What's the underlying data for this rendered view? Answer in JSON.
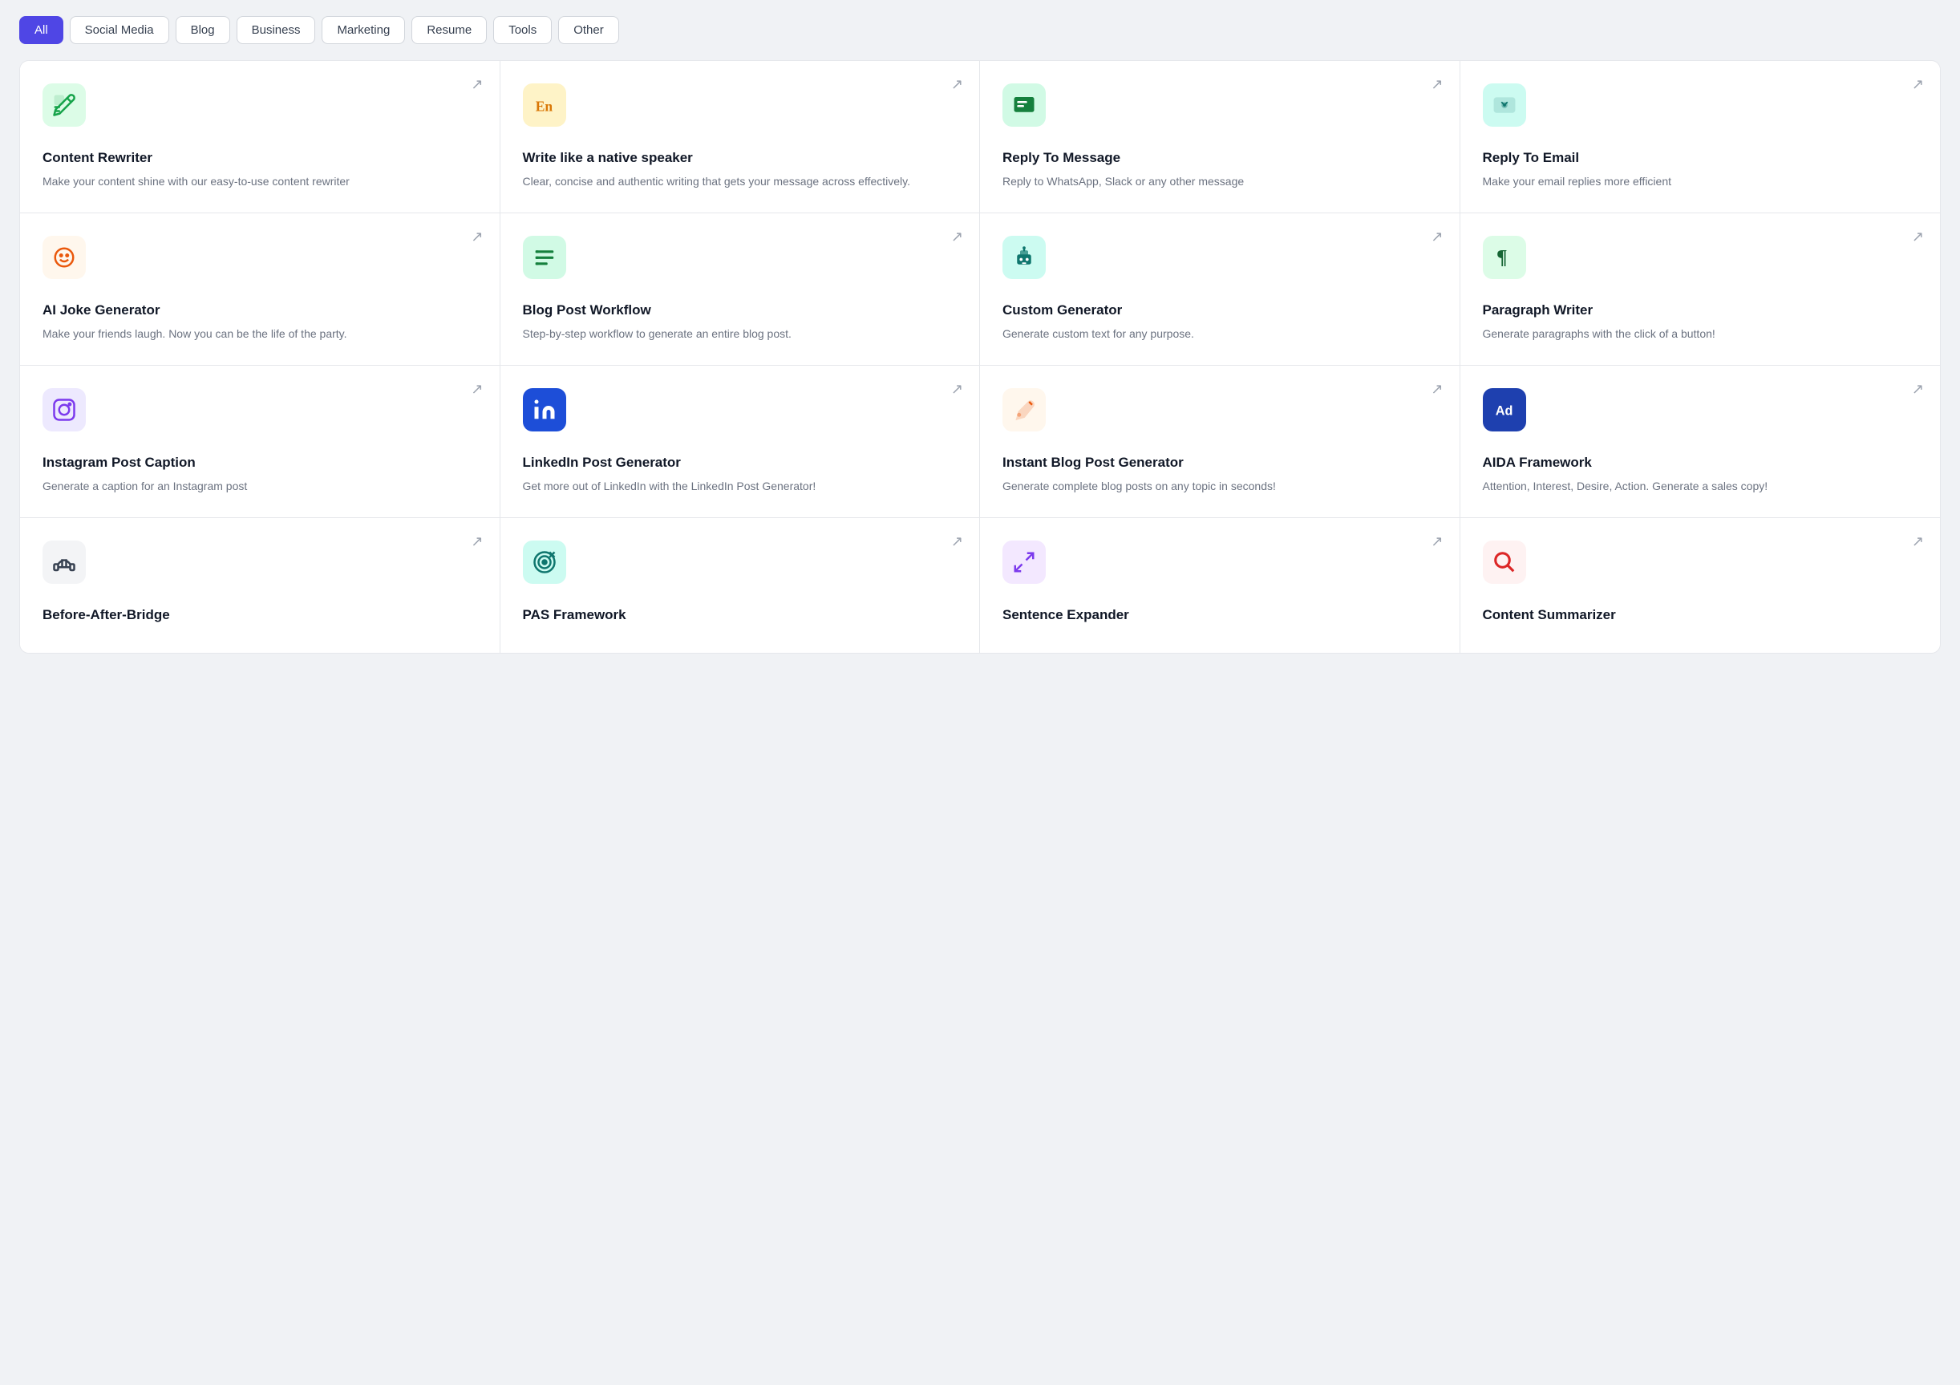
{
  "filters": {
    "items": [
      {
        "label": "All",
        "active": true
      },
      {
        "label": "Social Media",
        "active": false
      },
      {
        "label": "Blog",
        "active": false
      },
      {
        "label": "Business",
        "active": false
      },
      {
        "label": "Marketing",
        "active": false
      },
      {
        "label": "Resume",
        "active": false
      },
      {
        "label": "Tools",
        "active": false
      },
      {
        "label": "Other",
        "active": false
      }
    ]
  },
  "cards": [
    {
      "id": "content-rewriter",
      "title": "Content Rewriter",
      "desc": "Make your content shine with our easy-to-use content rewriter",
      "icon": "rewriter",
      "iconBg": "icon-green-light",
      "iconColor": "#16a34a"
    },
    {
      "id": "native-speaker",
      "title": "Write like a native speaker",
      "desc": "Clear, concise and authentic writing that gets your message across effectively.",
      "icon": "en",
      "iconBg": "icon-orange-light",
      "iconColor": "#d97706"
    },
    {
      "id": "reply-to-message",
      "title": "Reply To Message",
      "desc": "Reply to WhatsApp, Slack or any other message",
      "icon": "message",
      "iconBg": "icon-green-mid",
      "iconColor": "#15803d"
    },
    {
      "id": "reply-to-email",
      "title": "Reply To Email",
      "desc": "Make your email replies more efficient",
      "icon": "email",
      "iconBg": "icon-teal-light",
      "iconColor": "#0f766e"
    },
    {
      "id": "ai-joke-generator",
      "title": "AI Joke Generator",
      "desc": "Make your friends laugh. Now you can be the life of the party.",
      "icon": "smile",
      "iconBg": "icon-orange-red",
      "iconColor": "#ea580c"
    },
    {
      "id": "blog-post-workflow",
      "title": "Blog Post Workflow",
      "desc": "Step-by-step workflow to generate an entire blog post.",
      "icon": "list",
      "iconBg": "icon-green2",
      "iconColor": "#15803d"
    },
    {
      "id": "custom-generator",
      "title": "Custom Generator",
      "desc": "Generate custom text for any purpose.",
      "icon": "robot",
      "iconBg": "icon-teal2",
      "iconColor": "#0f766e"
    },
    {
      "id": "paragraph-writer",
      "title": "Paragraph Writer",
      "desc": "Generate paragraphs with the click of a button!",
      "icon": "paragraph",
      "iconBg": "icon-green3",
      "iconColor": "#166534"
    },
    {
      "id": "instagram-post-caption",
      "title": "Instagram Post Caption",
      "desc": "Generate a caption for an Instagram post",
      "icon": "instagram",
      "iconBg": "icon-purple",
      "iconColor": "#7c3aed"
    },
    {
      "id": "linkedin-post-generator",
      "title": "LinkedIn Post Generator",
      "desc": "Get more out of LinkedIn with the LinkedIn Post Generator!",
      "icon": "linkedin",
      "iconBg": "icon-blue-dark",
      "iconColor": "#fff"
    },
    {
      "id": "instant-blog-post",
      "title": "Instant Blog Post Generator",
      "desc": "Generate complete blog posts on any topic in seconds!",
      "icon": "pen",
      "iconBg": "icon-orange2",
      "iconColor": "#ea580c"
    },
    {
      "id": "aida-framework",
      "title": "AIDA Framework",
      "desc": "Attention, Interest, Desire, Action. Generate a sales copy!",
      "icon": "ad",
      "iconBg": "icon-blue2",
      "iconColor": "#fff"
    },
    {
      "id": "before-after-bridge",
      "title": "Before-After-Bridge",
      "desc": "",
      "icon": "bridge",
      "iconBg": "icon-gray",
      "iconColor": "#374151"
    },
    {
      "id": "pas-framework",
      "title": "PAS Framework",
      "desc": "",
      "icon": "target",
      "iconBg": "icon-teal3",
      "iconColor": "#0f766e"
    },
    {
      "id": "sentence-expander",
      "title": "Sentence Expander",
      "desc": "",
      "icon": "expand",
      "iconBg": "icon-purple2",
      "iconColor": "#7c3aed"
    },
    {
      "id": "content-summarizer",
      "title": "Content Summarizer",
      "desc": "",
      "icon": "search",
      "iconBg": "icon-red",
      "iconColor": "#dc2626"
    }
  ],
  "arrow": "↗"
}
